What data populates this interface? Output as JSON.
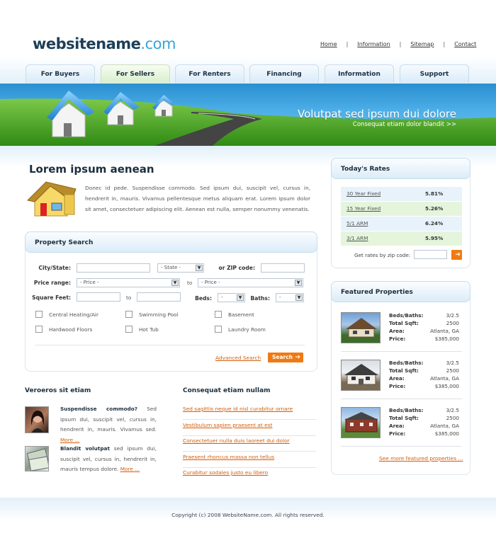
{
  "brand": {
    "name": "websitename",
    "domain": ".com"
  },
  "toplinks": [
    "Home",
    "Information",
    "Sitemap",
    "Contact"
  ],
  "tabs": [
    "For Buyers",
    "For Sellers",
    "For Renters",
    "Financing",
    "Information",
    "Support"
  ],
  "banner": {
    "title": "Volutpat sed ipsum dui dolore",
    "subtitle": "Consequat etiam dolor blandit >>"
  },
  "intro": {
    "heading": "Lorem ipsum aenean",
    "text": "Donec id pede. Suspendisse commodo. Sed ipsum dui, suscipit vel, cursus in, hendrerit in, mauris. Vivamus pellentesque metus aliquam erat. Lorem ipsum dolor sit amet, consectetuer adipiscing elit. Aenean est nulla, semper nonummy venenatis."
  },
  "search": {
    "title": "Property Search",
    "city_label": "City/State:",
    "state_value": "- State -",
    "zip_label": "or ZIP code:",
    "price_label": "Price range:",
    "price_from": "- Price -",
    "to1": "to",
    "price_to": "- Price -",
    "sqft_label": "Square Feet:",
    "to2": "to",
    "beds_label": "Beds:",
    "beds_value": "-",
    "baths_label": "Baths:",
    "baths_value": "-",
    "checkboxes": [
      "Central Heating/Air",
      "Swimming Pool",
      "Basement",
      "Hardwood Floors",
      "Hot Tub",
      "Laundry Room"
    ],
    "advanced": "Advanced Search",
    "search_btn": "Search"
  },
  "left_col": {
    "heading": "Veroeros sit etiam",
    "items": [
      {
        "title": "Suspendisse commodo?",
        "text": " Sed ipsum dui, suscipit vel, cursus in, hendrerit in, mauris. Vivamus sed.",
        "more": "More ..."
      },
      {
        "title": "Blandit volutpat",
        "text": " sed ipsum dui, suscipit vel, cursus in, hendrerit in, mauris tempus dolore.",
        "more": "More ..."
      }
    ]
  },
  "mid_col": {
    "heading": "Consequat etiam nullam",
    "links": [
      "Sed sagittis neque id nisl curabitur ornare",
      "Vestibulum sapien praesent at est",
      "Consectetuer nulla duis laoreet dui dolor",
      "Praesent rhoncus massa non tellus",
      "Curabitur sodales justo eu libero"
    ]
  },
  "rates": {
    "title": "Today's Rates",
    "rows": [
      {
        "name": "30 Year Fixed",
        "value": "5.81%"
      },
      {
        "name": "15 Year Fixed",
        "value": "5.26%"
      },
      {
        "name": "5/1 ARM",
        "value": "6.24%"
      },
      {
        "name": "3/1 ARM",
        "value": "5.95%"
      }
    ],
    "zip_label": "Get rates by zip code:"
  },
  "featured": {
    "title": "Featured Properties",
    "labels": {
      "beds": "Beds/Baths:",
      "sqft": "Total Sqft:",
      "area": "Area:",
      "price": "Price:"
    },
    "props": [
      {
        "beds": "3/2.5",
        "sqft": "2500",
        "area": "Atlanta, GA",
        "price": "$385,000"
      },
      {
        "beds": "3/2.5",
        "sqft": "2500",
        "area": "Atlanta, GA",
        "price": "$385,000"
      },
      {
        "beds": "3/2.5",
        "sqft": "2500",
        "area": "Atlanta, GA",
        "price": "$385,000"
      }
    ],
    "more": "See more featured properties ..."
  },
  "footer": {
    "copyright": "Copyright (c) 2008 WebsiteName.com. All rights reserved."
  },
  "colors": {
    "accent": "#f07a12",
    "navy": "#1d3f58",
    "sky": "#3aa4d4",
    "grass": "#3d9a1c"
  }
}
